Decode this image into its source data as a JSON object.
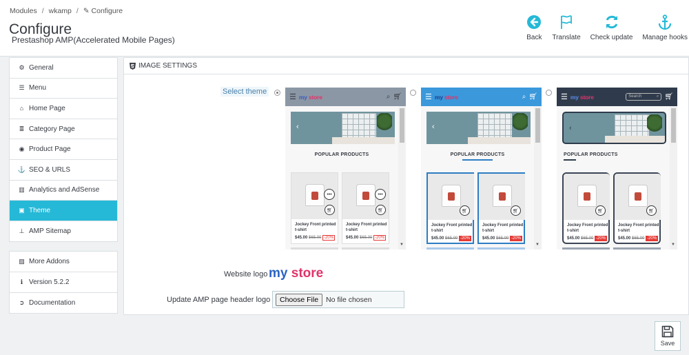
{
  "breadcrumb": [
    "Modules",
    "wkamp",
    "Configure"
  ],
  "page": {
    "title": "Configure",
    "subtitle": "Prestashop AMP(Accelerated Mobile Pages)"
  },
  "toolbar": [
    {
      "label": "Back",
      "icon": "back-arrow-icon",
      "color": "#25b9d7"
    },
    {
      "label": "Translate",
      "icon": "flag-icon",
      "color": "#25b9d7"
    },
    {
      "label": "Check update",
      "icon": "refresh-icon",
      "color": "#25b9d7"
    },
    {
      "label": "Manage hooks",
      "icon": "anchor-icon",
      "color": "#25b9d7"
    }
  ],
  "sidebar": {
    "items": [
      {
        "label": "General",
        "icon": "gears-icon"
      },
      {
        "label": "Menu",
        "icon": "menu-icon"
      },
      {
        "label": "Home Page",
        "icon": "home-icon"
      },
      {
        "label": "Category Page",
        "icon": "list-icon"
      },
      {
        "label": "Product Page",
        "icon": "eye-icon"
      },
      {
        "label": "SEO & URLS",
        "icon": "anchor-icon"
      },
      {
        "label": "Analytics and AdSense",
        "icon": "chart-icon"
      },
      {
        "label": "Theme",
        "icon": "html5-icon",
        "active": true
      },
      {
        "label": "AMP Sitemap",
        "icon": "sitemap-icon"
      }
    ],
    "extra": [
      {
        "label": "More Addons",
        "icon": "image-icon"
      },
      {
        "label": "Version 5.2.2",
        "icon": "info-icon"
      },
      {
        "label": "Documentation",
        "icon": "circle-arrow-icon"
      }
    ],
    "active_color": "#25b9d7"
  },
  "panel": {
    "heading": "IMAGE SETTINGS",
    "select_theme_label": "Select theme",
    "website_logo_label": "Website logo",
    "upload_label": "Update AMP page header logo",
    "file_button": "Choose File",
    "file_status": "No file chosen"
  },
  "themes": [
    {
      "checked": true,
      "bar_color": "#8b97a5",
      "logo": "my store",
      "show_search_box": false,
      "search_placeholder": ""
    },
    {
      "checked": false,
      "bar_color": "#3a98db",
      "logo": "my store",
      "show_search_box": false,
      "search_placeholder": ""
    },
    {
      "checked": false,
      "bar_color": "#2f3b4c",
      "logo": "my store",
      "show_search_box": true,
      "search_placeholder": "Search"
    }
  ],
  "theme_preview": {
    "section_title": "POPULAR PRODUCTS",
    "product_name": "Jockey Front printed t-shirt",
    "price": "$45.00",
    "old_price": "$65.00",
    "discount": "-20%"
  },
  "site_logo": {
    "part1": "my",
    "part2": "store",
    "color1": "#2b63c6",
    "color2": "#e0346a"
  },
  "save_label": "Save"
}
